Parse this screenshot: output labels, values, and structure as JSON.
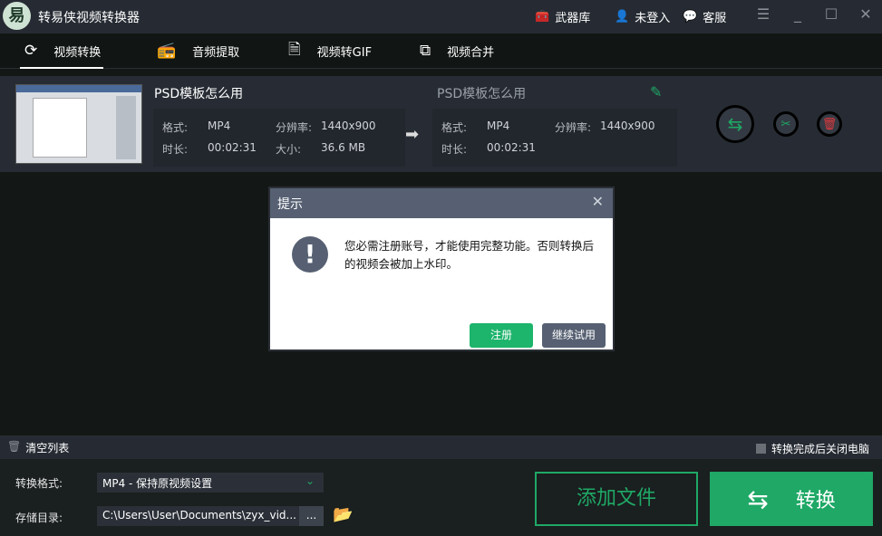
{
  "app": {
    "title": "转易侠视频转换器",
    "logo_text": "易"
  },
  "header": {
    "armory": "武器库",
    "login": "未登入",
    "service": "客服"
  },
  "tabs": [
    {
      "label": "视频转换"
    },
    {
      "label": "音频提取"
    },
    {
      "label": "视频转GIF"
    },
    {
      "label": "视频合并"
    }
  ],
  "file": {
    "name": "PSD模板怎么用",
    "output_name": "PSD模板怎么用",
    "format_label": "格式:",
    "format": "MP4",
    "resolution_label": "分辨率:",
    "resolution": "1440x900",
    "duration_label": "时长:",
    "duration": "00:02:31",
    "size_label": "大小:",
    "size": "36.6 MB",
    "out_format": "MP4",
    "out_resolution": "1440x900",
    "out_duration": "00:02:31"
  },
  "dialog": {
    "title": "提示",
    "message": "您必需注册账号，才能使用完整功能。否则转换后的视频会被加上水印。",
    "register": "注册",
    "continue": "继续试用"
  },
  "bottom": {
    "clear": "清空列表",
    "shutdown": "转换完成后关闭电脑",
    "format_label": "转换格式:",
    "format_value": "MP4 - 保持原视频设置",
    "dir_label": "存储目录:",
    "dir_value": "C:\\Users\\User\\Documents\\zyx_vid...",
    "browse": "...",
    "add_file": "添加文件",
    "convert": "转换"
  },
  "colors": {
    "accent": "#1fa866",
    "danger": "#e0393e",
    "dialog_header": "#566072"
  }
}
